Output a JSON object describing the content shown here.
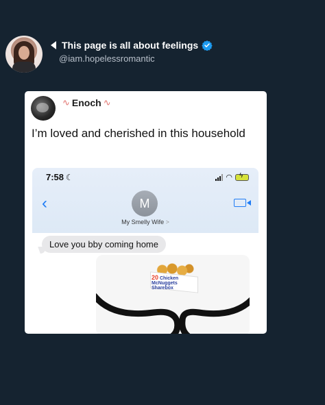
{
  "post": {
    "page_title": "This page is all about feelings",
    "handle": "@iam.hopelessromantic"
  },
  "tweet": {
    "author_name": "Enoch",
    "author_deco": "∿",
    "text": "I’m loved and cherished in this household"
  },
  "phone": {
    "time": "7:58",
    "contact_initial": "M",
    "contact_name": "My Smelly Wife",
    "contact_chevron": ">",
    "message": "Love you bby coming home",
    "attachment_label_count": "20",
    "attachment_label_line1": "Chicken",
    "attachment_label_line2": "McNuggets",
    "attachment_label_line3": "Sharebox"
  },
  "icons": {
    "back": "‹",
    "moon": "☾",
    "wifi": "◠"
  },
  "colors": {
    "background": "#152330",
    "verified": "#1d9bf0",
    "ios_blue": "#1f7cf5"
  }
}
